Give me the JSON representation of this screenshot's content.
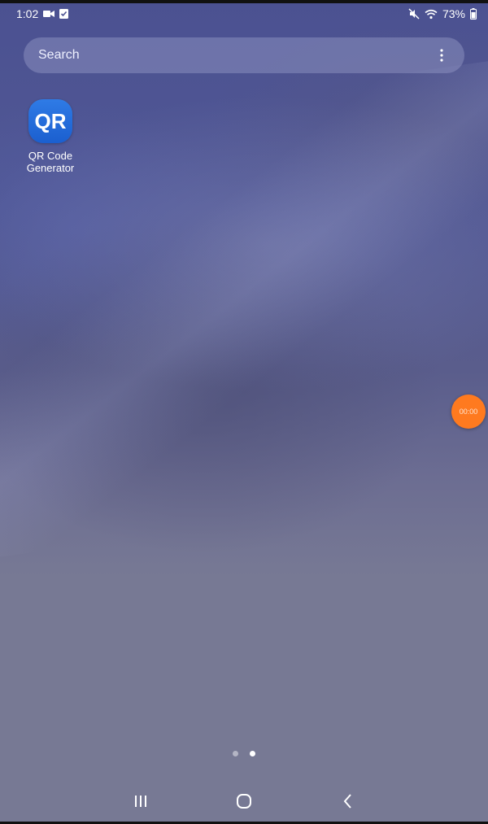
{
  "status_bar": {
    "time": "1:02",
    "battery": "73%",
    "icons": [
      "video-record-icon",
      "checklist-icon",
      "mute-icon",
      "wifi-icon",
      "battery-icon"
    ]
  },
  "search": {
    "label": "Search"
  },
  "apps": [
    {
      "name": "QR Code Generator",
      "icon_text": "QR"
    }
  ],
  "floating_timer": {
    "text": "00:00",
    "color": "#ff7a1f"
  },
  "pager": {
    "pages": 2,
    "active_index": 1
  },
  "nav": {
    "buttons": [
      "recent-apps",
      "home",
      "back"
    ]
  }
}
